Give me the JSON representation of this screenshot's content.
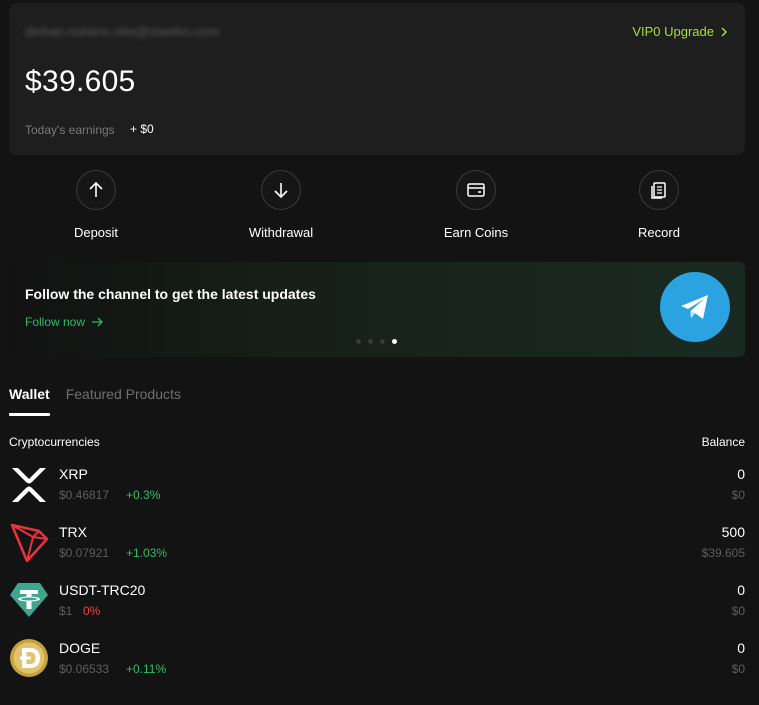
{
  "account": {
    "email": "dinhan.nuhens.nhe@siseilvs.com",
    "vip_label": "VIP0 Upgrade",
    "balance": "$39.605",
    "earnings_label": "Today's earnings",
    "earnings_value": "+ $0"
  },
  "actions": [
    {
      "label": "Deposit",
      "icon": "arrow-up-icon"
    },
    {
      "label": "Withdrawal",
      "icon": "arrow-down-icon"
    },
    {
      "label": "Earn Coins",
      "icon": "wallet-icon"
    },
    {
      "label": "Record",
      "icon": "document-icon"
    }
  ],
  "banner": {
    "title": "Follow the channel to get the latest updates",
    "link": "Follow now",
    "icon": "telegram-icon",
    "slides": 4,
    "active_slide": 4
  },
  "tabs": [
    {
      "label": "Wallet",
      "active": true
    },
    {
      "label": "Featured Products",
      "active": false
    }
  ],
  "table": {
    "left_header": "Cryptocurrencies",
    "right_header": "Balance",
    "rows": [
      {
        "name": "XRP",
        "price": "$0.46817",
        "change": "+0.3%",
        "trend": "up",
        "qty": "0",
        "value": "$0",
        "icon": "xrp-icon"
      },
      {
        "name": "TRX",
        "price": "$0.07921",
        "change": "+1.03%",
        "trend": "up",
        "qty": "500",
        "value": "$39.605",
        "icon": "trx-icon"
      },
      {
        "name": "USDT-TRC20",
        "price": "$1",
        "change": "0%",
        "trend": "down",
        "qty": "0",
        "value": "$0",
        "icon": "usdt-icon"
      },
      {
        "name": "DOGE",
        "price": "$0.06533",
        "change": "+0.11%",
        "trend": "up",
        "qty": "0",
        "value": "$0",
        "icon": "doge-icon"
      }
    ]
  },
  "colors": {
    "background": "#131313",
    "card": "#1e1e1f",
    "vip": "#a8dd3a",
    "positive": "#2ebd6b",
    "negative": "#e8473e",
    "telegram": "#2aa3e0"
  }
}
